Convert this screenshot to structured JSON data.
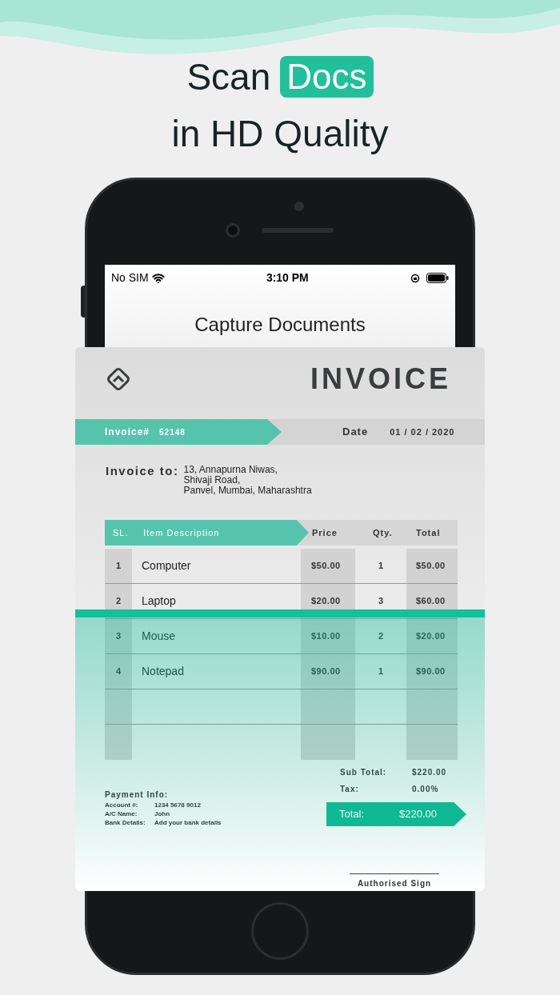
{
  "headline": {
    "line_1": "Scan",
    "highlight": "Docs",
    "line_2": "in HD Quality"
  },
  "status_bar": {
    "carrier": "No SIM",
    "time": "3:10 PM"
  },
  "screen": {
    "title": "Capture Documents"
  },
  "invoice": {
    "title": "INVOICE",
    "number_label": "Invoice#",
    "number": "52148",
    "date_label": "Date",
    "date": "01 / 02 / 2020",
    "to_label": "Invoice to:",
    "address": [
      "13, Annapurna Niwas,",
      "Shivaji Road,",
      "Panvel, Mumbai, Maharashtra"
    ],
    "columns": [
      "SL.",
      "Item Description",
      "Price",
      "Qty.",
      "Total"
    ],
    "rows": [
      {
        "sl": "1",
        "item": "Computer",
        "price": "$50.00",
        "qty": "1",
        "total": "$50.00"
      },
      {
        "sl": "2",
        "item": "Laptop",
        "price": "$20.00",
        "qty": "3",
        "total": "$60.00"
      },
      {
        "sl": "3",
        "item": "Mouse",
        "price": "$10.00",
        "qty": "2",
        "total": "$20.00"
      },
      {
        "sl": "4",
        "item": "Notepad",
        "price": "$90.00",
        "qty": "1",
        "total": "$90.00"
      }
    ],
    "sub_total_label": "Sub Total:",
    "sub_total": "$220.00",
    "tax_label": "Tax:",
    "tax": "0.00%",
    "payment": {
      "title": "Payment Info:",
      "fields": [
        {
          "label": "Account #:",
          "value": "1234 5678 9012"
        },
        {
          "label": "A/C Name:",
          "value": "John"
        },
        {
          "label": "Bank Details:",
          "value": "Add your bank details"
        }
      ]
    },
    "total_label": "Total:",
    "total": "$220.00",
    "sign": "Authorised Sign"
  }
}
